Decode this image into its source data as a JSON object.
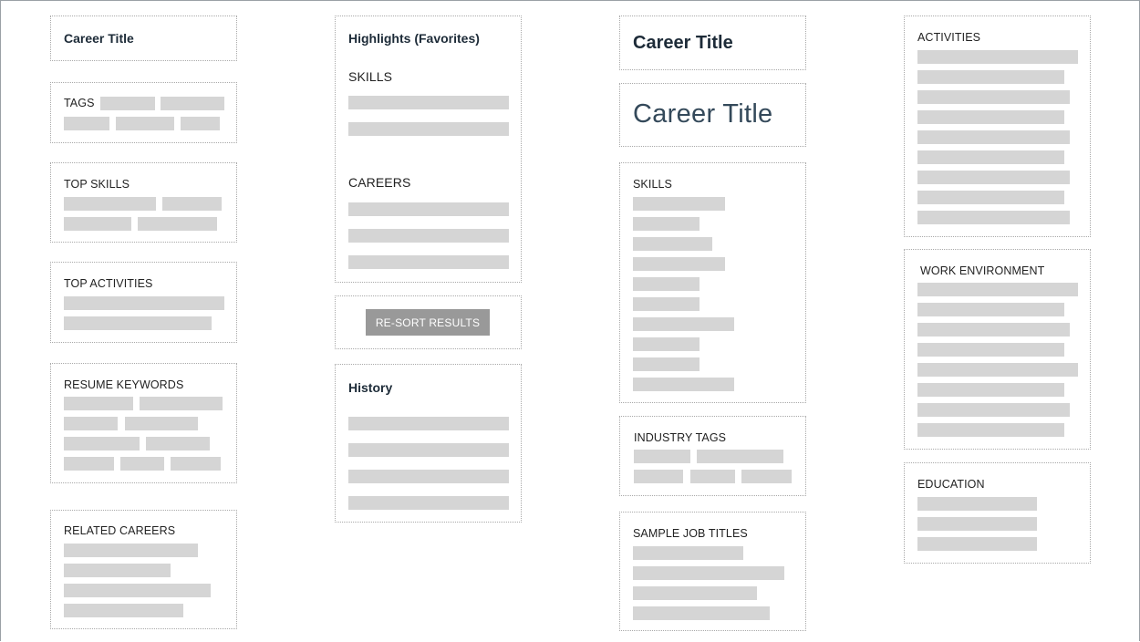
{
  "col1": {
    "career_title": "Career Title",
    "tags_label": "TAGS",
    "top_skills_label": "TOP SKILLS",
    "top_activities_label": "TOP ACTIVITIES",
    "resume_keywords_label": "RESUME KEYWORDS",
    "related_careers_label": "RELATED CAREERS"
  },
  "col2": {
    "highlights_title": "Highlights (Favorites)",
    "skills_label": "SKILLS",
    "careers_label": "CAREERS",
    "resort_button": "RE-SORT RESULTS",
    "history_title": "History"
  },
  "col3": {
    "career_title_medium": "Career Title",
    "career_title_large": "Career Title",
    "skills_label": "SKILLS",
    "industry_tags_label": "INDUSTRY TAGS",
    "sample_job_titles_label": "SAMPLE JOB TITLES"
  },
  "col4": {
    "activities_label": "ACTIVITIES",
    "work_environment_label": "WORK ENVIRONMENT",
    "education_label": "EDUCATION"
  },
  "colors": {
    "placeholder_bar": "#d5d5d5",
    "button_bg": "#999999",
    "title_text": "#1d2b38"
  }
}
